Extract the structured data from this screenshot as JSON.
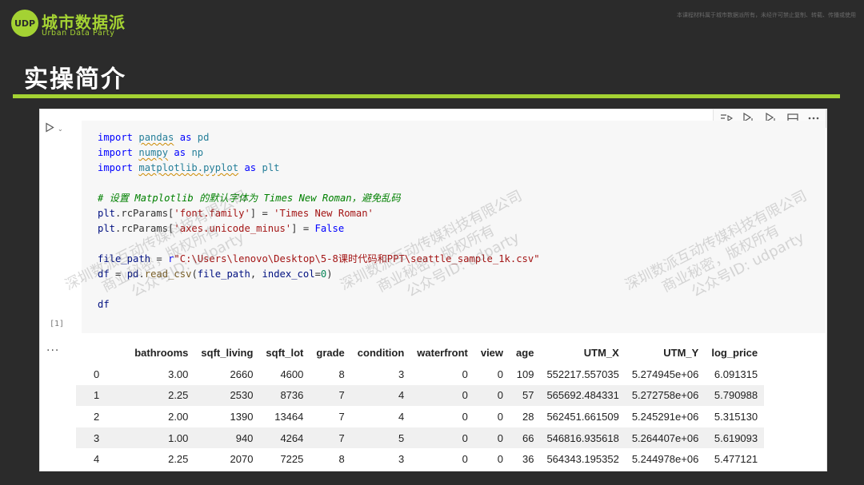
{
  "header": {
    "logo_text": "UDP",
    "brand_cn": "城市数据派",
    "brand_en": "Urban Data Party",
    "notice": "本课程材料属于城市数据派所有，未经许可禁止复制、转载、传播或使用",
    "title": "实操简介",
    "accent_color": "#a4d233"
  },
  "notebook": {
    "run_icon": "play-icon",
    "toolbar_icons": [
      "run-by-line-icon",
      "execute-above-icon",
      "execute-below-icon",
      "split-cell-icon",
      "more-icon"
    ],
    "execution_count": "[1]",
    "output_prefix": "...",
    "code_lines": [
      "import pandas as pd",
      "import numpy as np",
      "import matplotlib.pyplot as plt",
      "",
      "# 设置 Matplotlib 的默认字体为 Times New Roman，避免乱码",
      "plt.rcParams['font.family'] = 'Times New Roman'",
      "plt.rcParams['axes.unicode_minus'] = False",
      "",
      "file_path = r\"C:\\Users\\lenovo\\Desktop\\5-8课时代码和PPT\\seattle_sample_1k.csv\"",
      "df = pd.read_csv(file_path, index_col=0)",
      "",
      "df"
    ]
  },
  "dataframe": {
    "columns": [
      "bathrooms",
      "sqft_living",
      "sqft_lot",
      "grade",
      "condition",
      "waterfront",
      "view",
      "age",
      "UTM_X",
      "UTM_Y",
      "log_price"
    ],
    "rows": [
      {
        "index": "0",
        "values": [
          "3.00",
          "2660",
          "4600",
          "8",
          "3",
          "0",
          "0",
          "109",
          "552217.557035",
          "5.274945e+06",
          "6.091315"
        ]
      },
      {
        "index": "1",
        "values": [
          "2.25",
          "2530",
          "8736",
          "7",
          "4",
          "0",
          "0",
          "57",
          "565692.484331",
          "5.272758e+06",
          "5.790988"
        ]
      },
      {
        "index": "2",
        "values": [
          "2.00",
          "1390",
          "13464",
          "7",
          "4",
          "0",
          "0",
          "28",
          "562451.661509",
          "5.245291e+06",
          "5.315130"
        ]
      },
      {
        "index": "3",
        "values": [
          "1.00",
          "940",
          "4264",
          "7",
          "5",
          "0",
          "0",
          "66",
          "546816.935618",
          "5.264407e+06",
          "5.619093"
        ]
      },
      {
        "index": "4",
        "values": [
          "2.25",
          "2070",
          "7225",
          "8",
          "3",
          "0",
          "0",
          "36",
          "564343.195352",
          "5.244978e+06",
          "5.477121"
        ]
      }
    ]
  },
  "watermark": {
    "line1": "深圳数派互动传媒科技有限公司",
    "line2": "商业秘密，版权所有",
    "line3": "公众号ID: udparty"
  }
}
